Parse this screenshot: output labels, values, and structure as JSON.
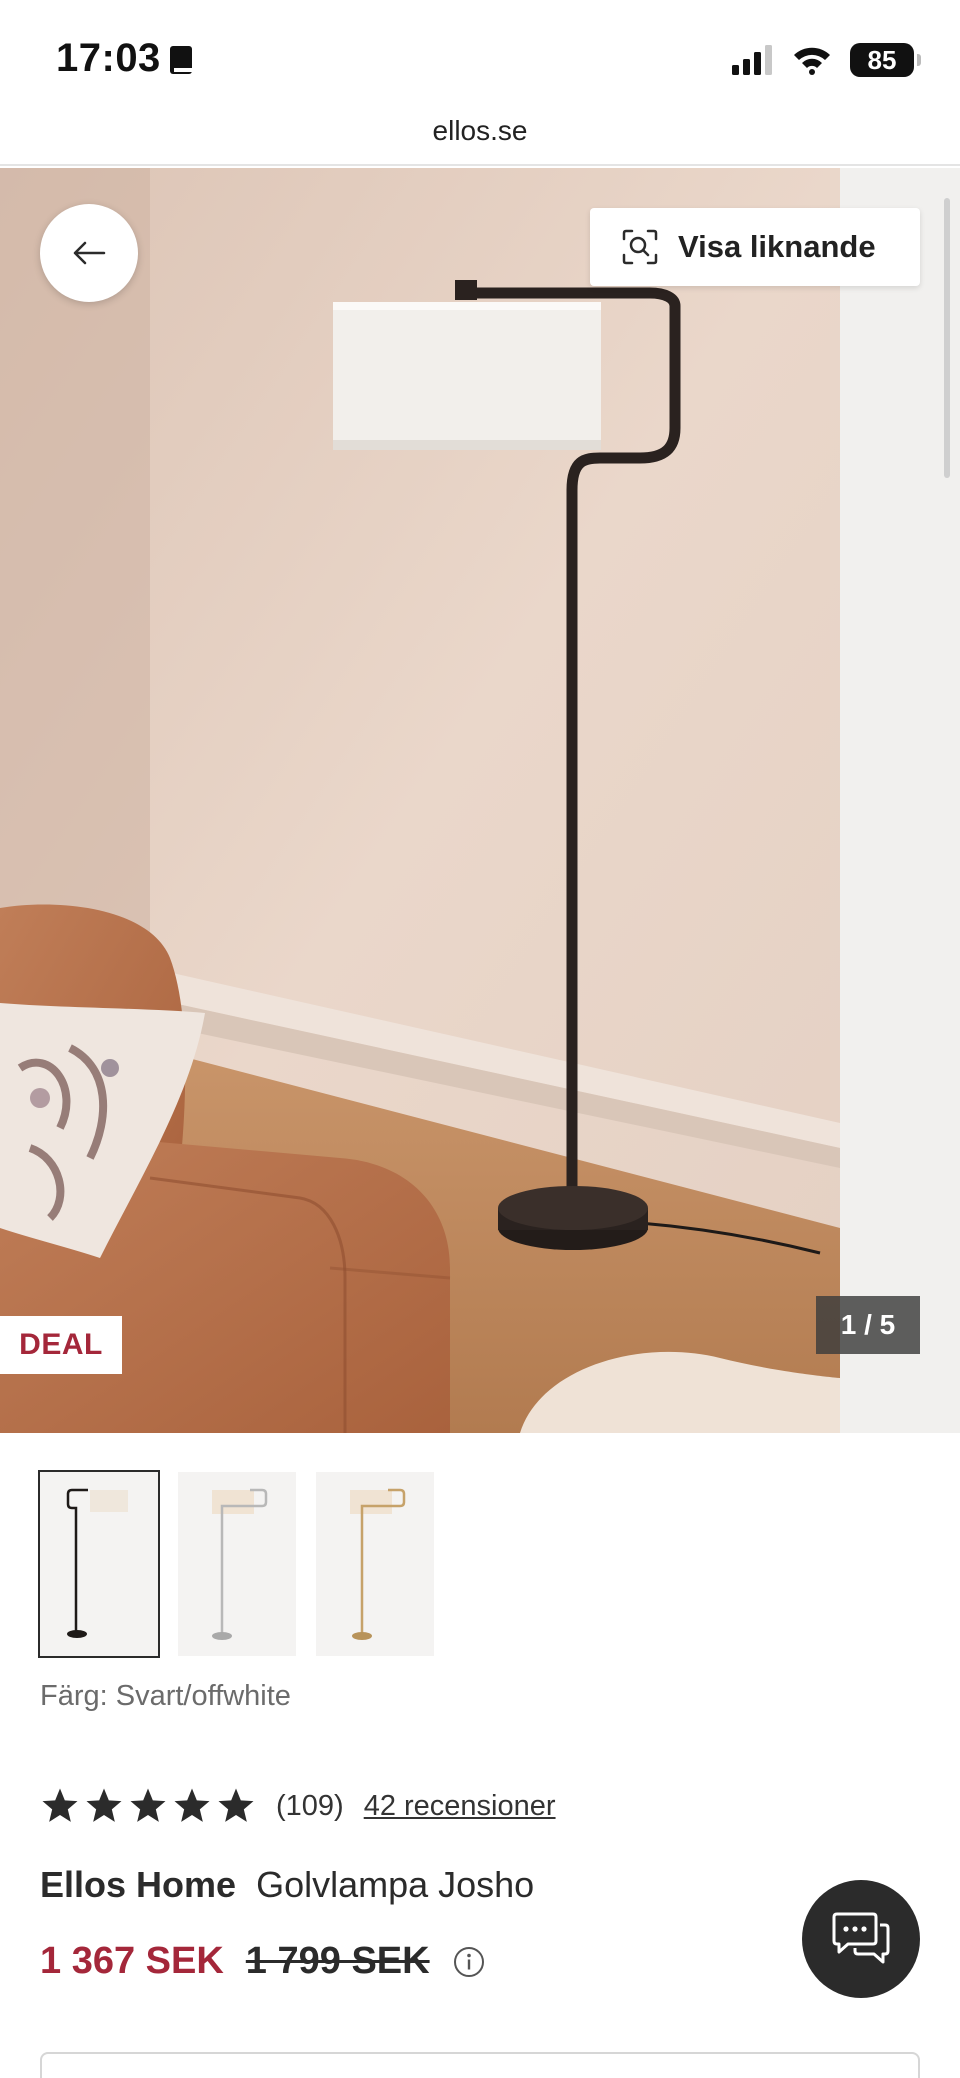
{
  "status_bar": {
    "time": "17:03",
    "battery": "85"
  },
  "browser": {
    "url": "ellos.se"
  },
  "hero": {
    "similar_label": "Visa liknande",
    "badge": "DEAL",
    "counter": "1 / 5"
  },
  "product": {
    "color_label": "Färg: Svart/offwhite",
    "rating": {
      "stars": 5,
      "count": "(109)",
      "reviews_link": "42 recensioner"
    },
    "brand": "Ellos Home",
    "name": "Golvlampa Josho",
    "price_now": "1 367 SEK",
    "price_was": "1 799 SEK"
  },
  "colors": {
    "deal": "#a4273a",
    "dark": "#2b2b2b"
  }
}
